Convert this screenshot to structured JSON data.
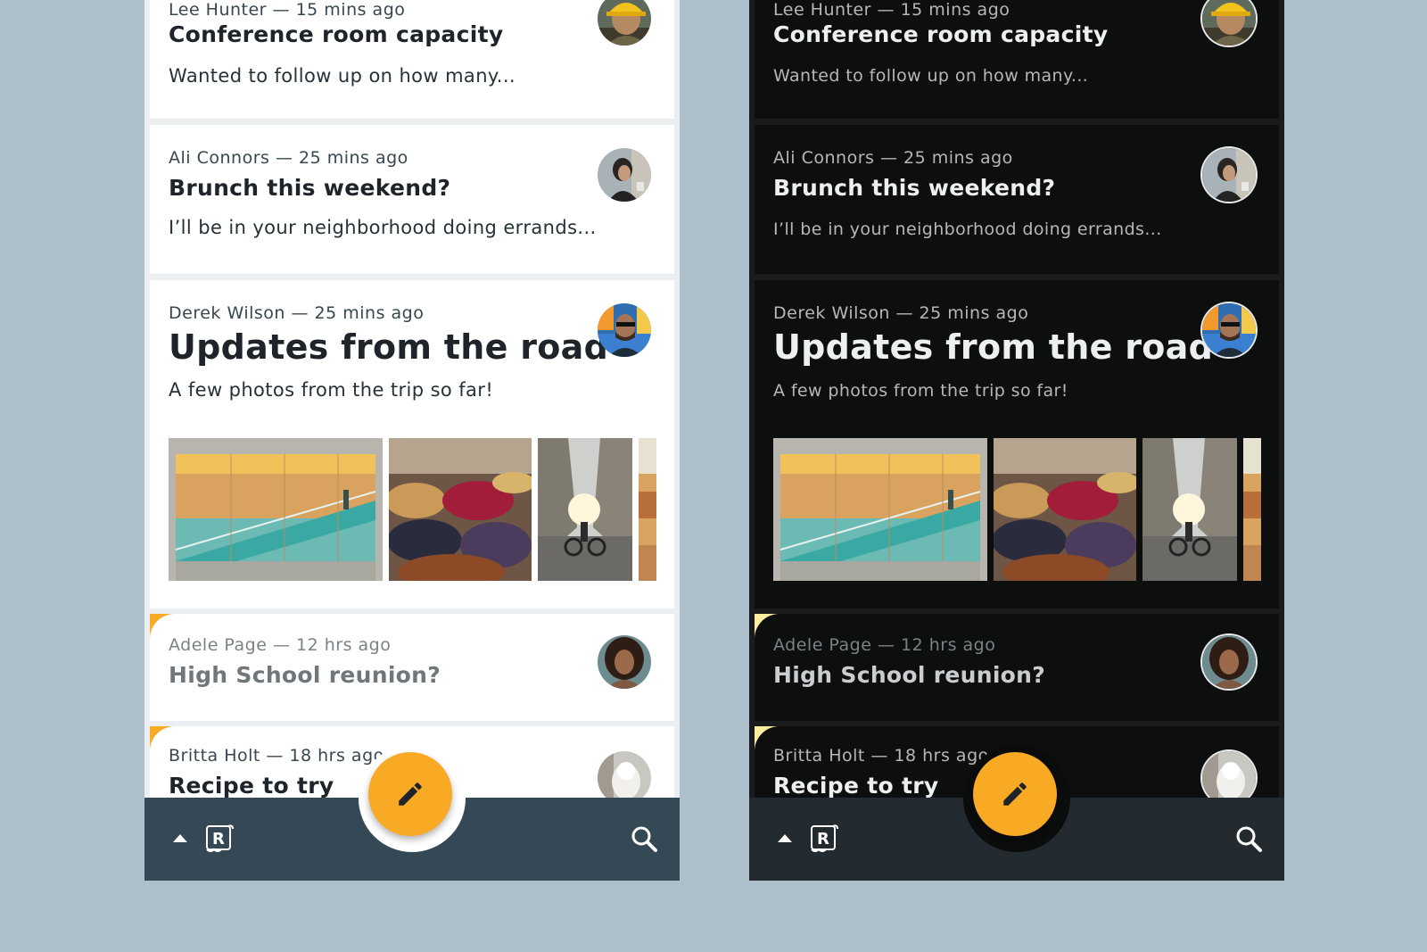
{
  "colors": {
    "backdrop": "#aebfcc",
    "accent": "#f9aa25",
    "light_bar": "#344955",
    "dark_bar": "#232b31",
    "unread_corner_light": "#f9aa25",
    "unread_corner_dark": "#fdeea0"
  },
  "icons": {
    "bottom_left": "arrow-up-icon",
    "logo": "reply-logo-icon",
    "bottom_right": "search-icon",
    "fab": "pencil-icon"
  },
  "emails": [
    {
      "sender": "Lee Hunter",
      "time": "15 mins ago",
      "meta": "Lee Hunter — 15 mins ago",
      "subject": "Conference room capacity",
      "preview": "Wanted to follow up on how many...",
      "read": false,
      "avatar": "avatar-lee"
    },
    {
      "sender": "Ali Connors",
      "time": "25 mins ago",
      "meta": "Ali Connors — 25 mins ago",
      "subject": "Brunch this weekend?",
      "preview": "I’ll be in your neighborhood doing errands...",
      "read": false,
      "avatar": "avatar-ali"
    },
    {
      "sender": "Derek Wilson",
      "time": "25 mins ago",
      "meta": "Derek Wilson — 25 mins ago",
      "subject": "Updates from the road",
      "preview": "A few photos from the trip so far!",
      "read": false,
      "avatar": "avatar-derek",
      "attachments": 4
    },
    {
      "sender": "Adele Page",
      "time": "12 hrs ago",
      "meta": "Adele Page — 12 hrs ago",
      "subject": "High School reunion?",
      "preview": "",
      "read": true,
      "avatar": "avatar-adele"
    },
    {
      "sender": "Britta Holt",
      "time": "18 hrs ago",
      "meta": "Britta Holt — 18 hrs ago",
      "subject": "Recipe to try",
      "preview": "",
      "read": true,
      "avatar": "avatar-britta"
    }
  ]
}
